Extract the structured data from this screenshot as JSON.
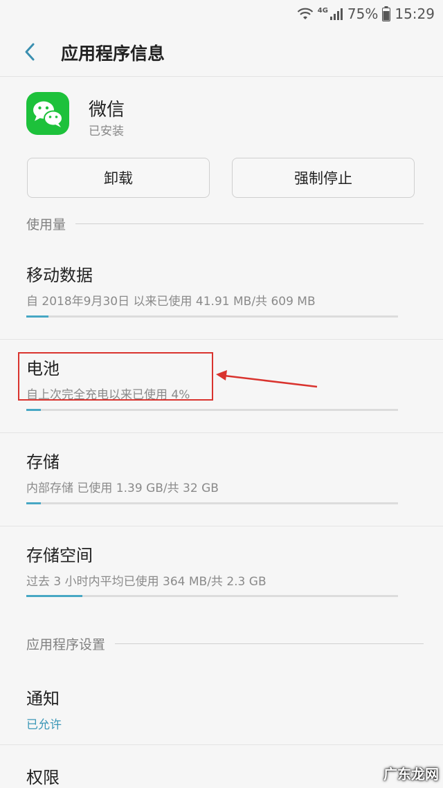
{
  "status_bar": {
    "battery_pct": "75%",
    "time": "15:29",
    "network": "4G"
  },
  "header": {
    "title": "应用程序信息"
  },
  "app": {
    "name": "微信",
    "status": "已安装",
    "icon": "wechat-icon",
    "icon_color": "#1dc13b"
  },
  "buttons": {
    "uninstall": "卸载",
    "force_stop": "强制停止"
  },
  "usage_section": {
    "label": "使用量",
    "items": [
      {
        "title": "移动数据",
        "sub": "自 2018年9月30日 以来已使用 41.91 MB/共 609 MB",
        "progress": 0.06
      },
      {
        "title": "电池",
        "sub": "自上次完全充电以来已使用 4%",
        "progress": 0.04
      },
      {
        "title": "存储",
        "sub": "内部存储 已使用 1.39 GB/共 32 GB",
        "progress": 0.04
      },
      {
        "title": "存储空间",
        "sub": "过去 3 小时内平均已使用 364 MB/共 2.3 GB",
        "progress": 0.15
      }
    ]
  },
  "settings_section": {
    "label": "应用程序设置",
    "items": [
      {
        "title": "通知",
        "sub": "已允许"
      },
      {
        "title": "权限"
      }
    ]
  },
  "watermark": "广东龙网",
  "colors": {
    "accent": "#47a7c4",
    "annotation": "#d9332e",
    "background": "#f6f6f6"
  }
}
